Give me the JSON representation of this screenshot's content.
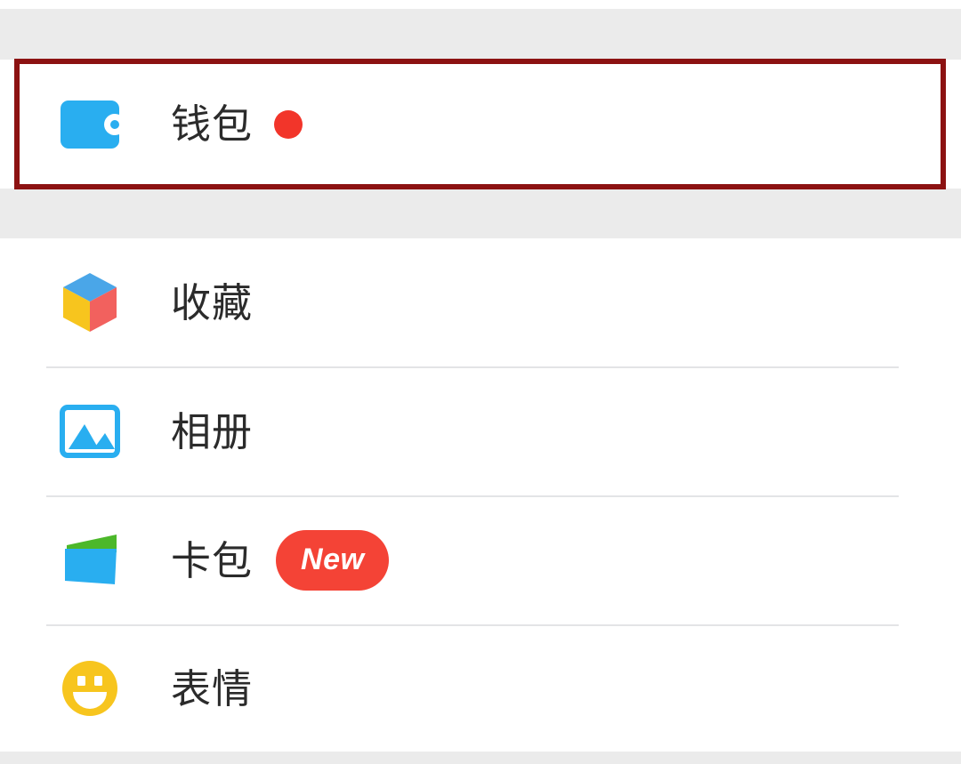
{
  "theme": {
    "page_background": "#ffffff",
    "gap_background": "#ebebeb",
    "separator_color": "#e3e4e6",
    "label_color": "#2b2b2b",
    "highlight_border_color": "#8c1212",
    "icon_blue": "#29aef0",
    "icon_yellow": "#f7c51e",
    "icon_red": "#f2615e",
    "icon_green": "#4cb82a",
    "badge_red": "#f44336",
    "dot_red": "#f2352a"
  },
  "highlight": {
    "name": "wallet-row-highlight",
    "target": "wallet"
  },
  "wallet_section": {
    "item": {
      "id": "wallet",
      "label": "钱包",
      "icon": "wallet-icon",
      "badge_type": "dot",
      "badge_label": ""
    }
  },
  "list_section": {
    "items": [
      {
        "id": "favorites",
        "label": "收藏",
        "icon": "cube-icon",
        "badge_type": "none",
        "badge_label": ""
      },
      {
        "id": "album",
        "label": "相册",
        "icon": "photo-icon",
        "badge_type": "none",
        "badge_label": ""
      },
      {
        "id": "cards",
        "label": "卡包",
        "icon": "card-package-icon",
        "badge_type": "pill",
        "badge_label": "New"
      },
      {
        "id": "emoji",
        "label": "表情",
        "icon": "smiley-icon",
        "badge_type": "none",
        "badge_label": ""
      }
    ]
  }
}
